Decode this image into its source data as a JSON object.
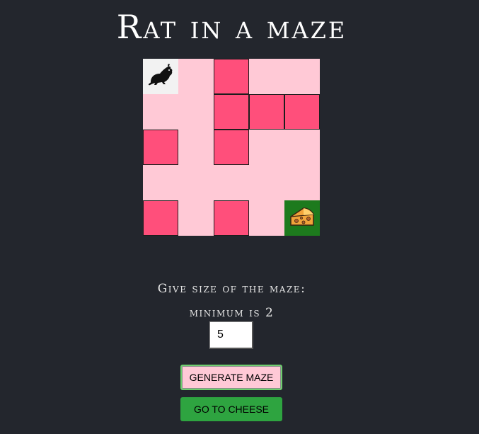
{
  "title": "Rat in a maze",
  "maze": {
    "rows": [
      [
        "start",
        "open",
        "wall",
        "open",
        "open"
      ],
      [
        "open",
        "open",
        "wall",
        "wall",
        "wall"
      ],
      [
        "wall",
        "open",
        "wall",
        "open",
        "open"
      ],
      [
        "open",
        "open",
        "open",
        "open",
        "open"
      ],
      [
        "wall",
        "open",
        "wall",
        "open",
        "goal"
      ]
    ],
    "start_icon": "rat-icon",
    "goal_icon": "cheese-icon",
    "colors": {
      "open": "#ffc9d6",
      "wall": "#ff4f7b",
      "start": "#f2f2f2",
      "goal": "#1d7a1d"
    }
  },
  "form": {
    "size_label": "Give size of the maze:",
    "minimum_label": "minimum is 2",
    "size_value": "5",
    "generate_label": "GENERATE MAZE",
    "cheese_label": "GO TO CHEESE"
  },
  "colors": {
    "background": "#23262d",
    "generate_button": "#ffc9d6",
    "cheese_button": "#2ea440"
  }
}
